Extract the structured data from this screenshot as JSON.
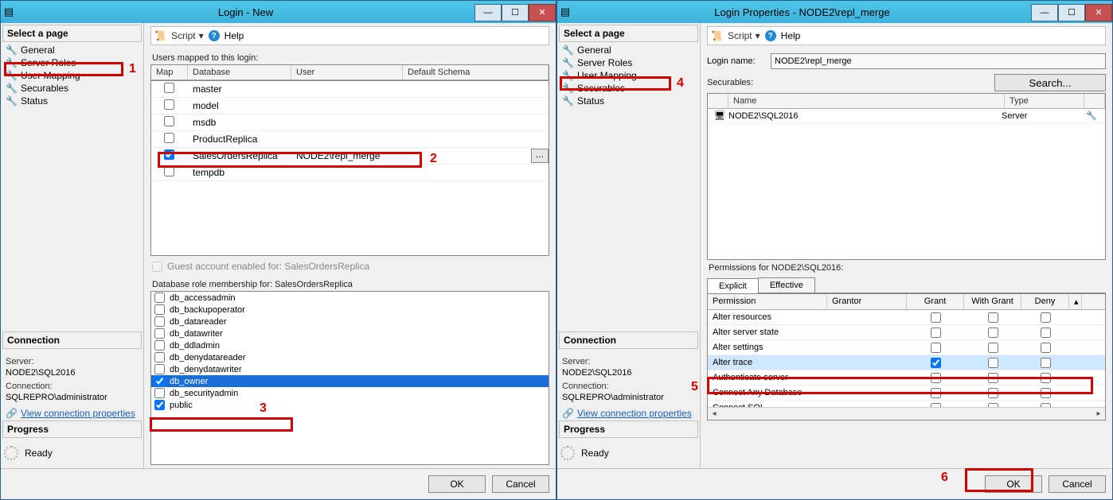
{
  "dialog1": {
    "title": "Login - New",
    "select_page": "Select a page",
    "pages": [
      "General",
      "Server Roles",
      "User Mapping",
      "Securables",
      "Status"
    ],
    "connection_title": "Connection",
    "server_label": "Server:",
    "server_val": "NODE2\\SQL2016",
    "conn_label": "Connection:",
    "conn_val": "SQLREPRO\\administrator",
    "view_conn": "View connection properties",
    "progress_title": "Progress",
    "ready": "Ready",
    "script": "Script",
    "help": "Help",
    "users_mapped": "Users mapped to this login:",
    "cols": {
      "map": "Map",
      "db": "Database",
      "user": "User",
      "schema": "Default Schema"
    },
    "db_rows": [
      {
        "checked": false,
        "db": "master",
        "user": "",
        "schema": ""
      },
      {
        "checked": false,
        "db": "model",
        "user": "",
        "schema": ""
      },
      {
        "checked": false,
        "db": "msdb",
        "user": "",
        "schema": ""
      },
      {
        "checked": false,
        "db": "ProductReplica",
        "user": "",
        "schema": ""
      },
      {
        "checked": true,
        "db": "SalesOrdersReplica",
        "user": "NODE2\\repl_merge",
        "schema": ""
      },
      {
        "checked": false,
        "db": "tempdb",
        "user": "",
        "schema": ""
      }
    ],
    "guest": "Guest account enabled for: SalesOrdersReplica",
    "role_label": "Database role membership for: SalesOrdersReplica",
    "roles": [
      {
        "name": "db_accessadmin",
        "checked": false
      },
      {
        "name": "db_backupoperator",
        "checked": false
      },
      {
        "name": "db_datareader",
        "checked": false
      },
      {
        "name": "db_datawriter",
        "checked": false
      },
      {
        "name": "db_ddladmin",
        "checked": false
      },
      {
        "name": "db_denydatareader",
        "checked": false
      },
      {
        "name": "db_denydatawriter",
        "checked": false
      },
      {
        "name": "db_owner",
        "checked": true,
        "selected": true
      },
      {
        "name": "db_securityadmin",
        "checked": false
      },
      {
        "name": "public",
        "checked": true
      }
    ],
    "ok": "OK",
    "cancel": "Cancel"
  },
  "dialog2": {
    "title": "Login Properties - NODE2\\repl_merge",
    "select_page": "Select a page",
    "pages": [
      "General",
      "Server Roles",
      "User Mapping",
      "Securables",
      "Status"
    ],
    "connection_title": "Connection",
    "server_label": "Server:",
    "server_val": "NODE2\\SQL2016",
    "conn_label": "Connection:",
    "conn_val": "SQLREPRO\\administrator",
    "view_conn": "View connection properties",
    "progress_title": "Progress",
    "ready": "Ready",
    "script": "Script",
    "help": "Help",
    "login_name_label": "Login name:",
    "login_name_val": "NODE2\\repl_merge",
    "securables_label": "Securables:",
    "search": "Search...",
    "sec_cols": {
      "name": "Name",
      "type": "Type"
    },
    "sec_rows": [
      {
        "name": "NODE2\\SQL2016",
        "type": "Server"
      }
    ],
    "perm_label": "Permissions for NODE2\\SQL2016:",
    "tabs": {
      "explicit": "Explicit",
      "effective": "Effective"
    },
    "perm_cols": {
      "perm": "Permission",
      "grantor": "Grantor",
      "grant": "Grant",
      "withgrant": "With Grant",
      "deny": "Deny"
    },
    "perm_rows": [
      {
        "perm": "Alter resources",
        "grant": false,
        "wg": false,
        "deny": false
      },
      {
        "perm": "Alter server state",
        "grant": false,
        "wg": false,
        "deny": false
      },
      {
        "perm": "Alter settings",
        "grant": false,
        "wg": false,
        "deny": false
      },
      {
        "perm": "Alter trace",
        "grant": true,
        "wg": false,
        "deny": false,
        "sel": true
      },
      {
        "perm": "Authenticate server",
        "grant": false,
        "wg": false,
        "deny": false
      },
      {
        "perm": "Connect Any Database",
        "grant": false,
        "wg": false,
        "deny": false
      },
      {
        "perm": "Connect SQL",
        "grant": false,
        "wg": false,
        "deny": false
      }
    ],
    "ok": "OK",
    "cancel": "Cancel"
  },
  "annotations": {
    "a1": "1",
    "a2": "2",
    "a3": "3",
    "a4": "4",
    "a5": "5",
    "a6": "6"
  }
}
